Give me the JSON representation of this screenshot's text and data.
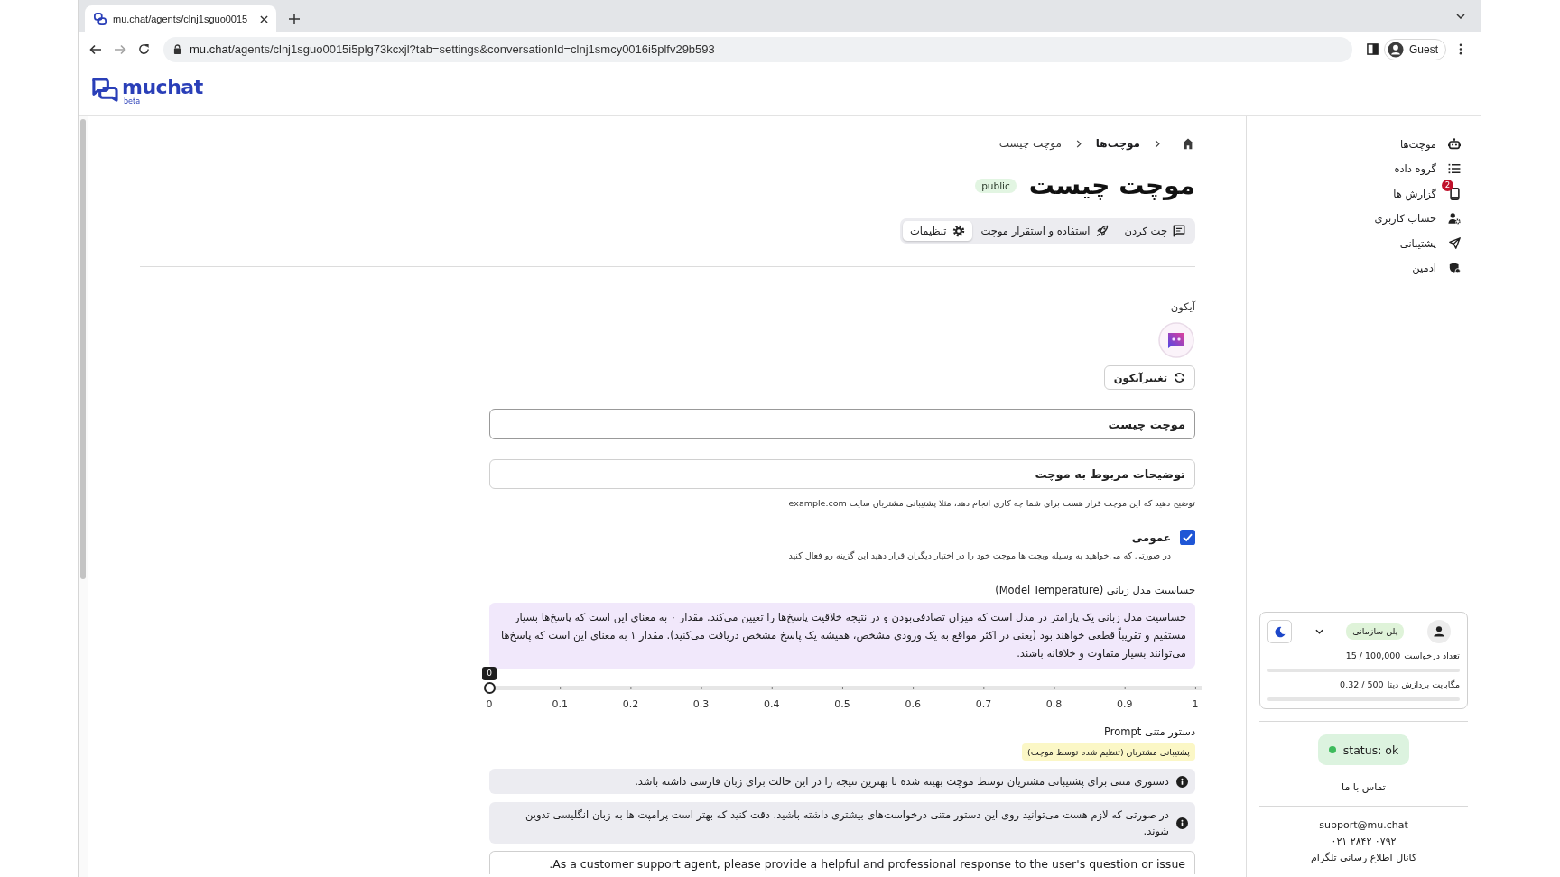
{
  "browser": {
    "tab": {
      "title": "mu.chat/agents/clnj1sguo0015"
    },
    "url": {
      "host": "mu.chat",
      "path": "/agents/clnj1sguo0015i5plg73kcxjl?tab=settings&conversationId=clnj1smcy0016i5plfv29b593"
    },
    "profile": {
      "label": "Guest"
    }
  },
  "header": {
    "logo": {
      "name": "muchat",
      "tag": "beta"
    }
  },
  "breadcrumbs": [
    {
      "kind": "home"
    },
    {
      "kind": "link",
      "label": "موچت‌ها"
    },
    {
      "kind": "current",
      "label": "موچت چیست"
    }
  ],
  "page": {
    "title": "موچت چیست",
    "badge": "public"
  },
  "tabs": [
    {
      "label": "چت کردن",
      "selected": false
    },
    {
      "label": "استفاده و استقرار موچت",
      "selected": false
    },
    {
      "label": "تنظیمات",
      "selected": true
    }
  ],
  "form": {
    "icon": {
      "label": "آیکون",
      "button": "تغییرآیکون"
    },
    "name_field": {
      "value": "موچت چیست"
    },
    "description_field": {
      "value": "توضیحات مربوط به موچت",
      "hint": "توضیح دهید که این موچت قرار هست برای شما چه کاری انجام دهد، مثلا پشتیبانی مشتریان سایت example.com"
    },
    "public": {
      "label": "عمومی",
      "checked": true,
      "hint": "در صورتی که می‌خواهید به وسیله ویجت ها موچت خود را در اختیار دیگران قرار دهید این گزینه رو فعال کنید"
    },
    "temperature": {
      "label": "حساسیت مدل زبانی (Model Temperature)",
      "info": "حساسیت مدل زبانی یک پارامتر در مدل است که میزان تصادفی‌بودن و در نتیجه خلاقیت پاسخ‌ها را تعیین می‌کند. مقدار ۰ به معنای این است که پاسخ‌ها بسیار مستقیم و تقریباً قطعی خواهند بود (یعنی در اکثر مواقع به یک ورودی مشخص، همیشه یک پاسخ مشخص دریافت می‌کنید). مقدار ۱ به معنای این است که پاسخ‌ها می‌توانند بسیار متفاوت و خلاقانه باشند.",
      "slider": {
        "level": 0,
        "value_label": "0",
        "ticks": [
          "1",
          "0.9",
          "0.8",
          "0.7",
          "0.6",
          "0.5",
          "0.4",
          "0.3",
          "0.2",
          "0.1",
          "0"
        ]
      }
    },
    "prompt": {
      "label": "دستور متنی Prompt",
      "preset_badge": "پشتیبانی مشتریان (تنظیم شده توسط موچت)",
      "notes": [
        "دستوری متنی برای پشتیبانی مشتریان توسط موچت بهینه شده تا بهترین نتیجه را در این حالت برای زبان فارسی داشته باشد.",
        "در صورتی که لازم هست می‌توانید روی این دستور متنی درخواست‌های بیشتری داشته باشید. دقت کنید که بهتر است پرامپت ها به زبان انگلیسی تدوین شوند."
      ],
      "value": "As a customer support agent, please provide a helpful and professional response to the user's question or issue."
    }
  },
  "sidebar": {
    "nav": [
      {
        "label": "موچت‌ها"
      },
      {
        "label": "گروه داده"
      },
      {
        "label": "گزارش ها",
        "badge": "2"
      },
      {
        "label": "حساب کاربری"
      },
      {
        "label": "پشتیبانی"
      },
      {
        "label": "ادمین"
      }
    ],
    "plan_card": {
      "plan": "پلن سازمانی",
      "usage": [
        {
          "value": "15 / 100,000",
          "label": "تعداد درخواست"
        },
        {
          "value": "0.32 / 500",
          "label": "مگابایت پردازش دیتا"
        }
      ]
    },
    "status": {
      "label": "status: ok"
    },
    "contact": {
      "title": "تماس با ما",
      "email": "support@mu.chat",
      "phone": "۰۲۱ ۲۸۴۲ ۰۷۹۲",
      "channel": "کانال اطلاع رسانی تلگرام"
    }
  }
}
